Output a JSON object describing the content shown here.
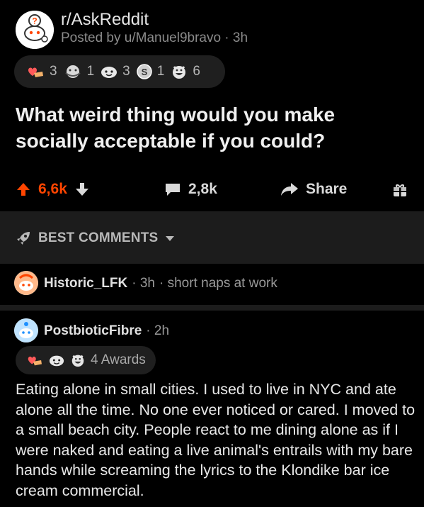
{
  "post": {
    "subreddit": "r/AskReddit",
    "posted_by": "Posted by u/Manuel9bravo · 3h",
    "awards": [
      {
        "icon": "heart-hand-award-icon",
        "count": "3"
      },
      {
        "icon": "hug-award-icon",
        "count": "1"
      },
      {
        "icon": "wholesome-award-icon",
        "count": "3"
      },
      {
        "icon": "silver-award-icon",
        "count": "1"
      },
      {
        "icon": "laughing-award-icon",
        "count": "6"
      }
    ],
    "title": "What weird thing would you make socially acceptable if you could?",
    "upvotes": "6,6k",
    "comments": "2,8k",
    "share_label": "Share"
  },
  "sort": {
    "label": "BEST COMMENTS"
  },
  "comments": [
    {
      "author": "Historic_LFK",
      "time": "· 3h",
      "inline_text": "· short naps at work"
    },
    {
      "author": "PostbioticFibre",
      "time": "· 2h",
      "awards_label": "4 Awards",
      "text": "Eating alone in small cities. I used to live in NYC and ate alone all the time. No one ever noticed or cared. I moved to a small beach city. People react to me dining alone as if I were naked and eating a live animal's entrails with my bare hands while screaming the lyrics to the Klondike bar ice cream commercial."
    }
  ],
  "colors": {
    "upvote": "#ff4500",
    "background": "#000000",
    "band": "#1c1c1c"
  }
}
